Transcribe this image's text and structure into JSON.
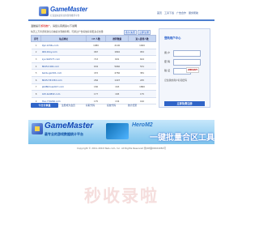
{
  "header": {
    "logo_title": "GameMaster",
    "logo_subtitle": "打造最好最专业的游戏推荐平台",
    "top_links": [
      "首页",
      "工具下载",
      "广告合作",
      "服务帮助"
    ]
  },
  "notice": {
    "prefix": "温馨提示",
    "red": "游戏推广",
    "suffix": "，请您认真阅读以下说明"
  },
  "intro": "每天上万条游戏新信息被提交到推荐网，可通过广告投放获得更多点击量",
  "register_tabs": [
    "永久免费",
    "立即注册"
  ],
  "table": {
    "headers": [
      "序号",
      "站点地址",
      "I P 人数",
      "推荐数量",
      "进入游戏人数"
    ],
    "rows": [
      [
        "1",
        "9yk.1234s.com",
        "1080",
        "2100",
        "1000"
      ],
      [
        "2",
        "009.91xy.com",
        "967",
        "1840",
        "952"
      ],
      [
        "3",
        "zyx.9k2577.com",
        "713",
        "691",
        "624"
      ],
      [
        "4",
        "8045.h400.com",
        "634",
        "5660",
        "531"
      ],
      [
        "5",
        "baidu-gsr201.com",
        "472",
        "4760",
        "381"
      ],
      [
        "6",
        "8045.H31332.com",
        "264",
        "1407",
        "245"
      ],
      [
        "7",
        "pk086.tuan617.com",
        "182",
        "163",
        "1860"
      ],
      [
        "8",
        "415.bzd832.com",
        "177",
        "165",
        "175"
      ],
      [
        "9",
        "Hoo.YY6266.com",
        "175",
        "134",
        "162"
      ]
    ]
  },
  "steps": {
    "button": "今日分享量",
    "items": [
      "注册成为会员",
      "获取代码",
      "投放代码",
      "统计结果"
    ]
  },
  "login": {
    "title": "登陆用户中心",
    "user_label": "用 户",
    "pass_label": "密 码",
    "code_label": "验 证",
    "captcha": "NR42H",
    "remember": "记住我的用户名和密码",
    "submit": "立即免费注册"
  },
  "banner": {
    "title": "GameMaster",
    "subtitle": "最专业的游戏数据统计平台",
    "hero": "HeroM2",
    "hero_sub": "一键批量合区工具"
  },
  "footer": "Copyright © 2011-2016 Web.com, Inc. All Rights Reserved 鲁ICP备09024981号",
  "watermark": "秒收录啦"
}
